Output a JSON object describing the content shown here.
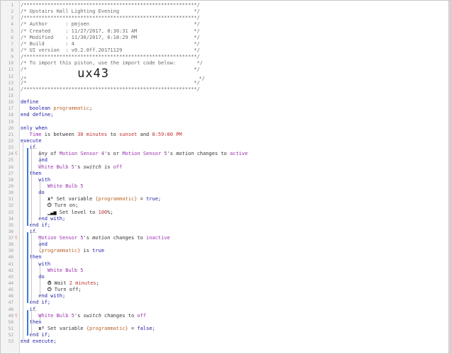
{
  "colors": {
    "keyword": "#1a1aa6",
    "device": "#9b2fae",
    "number": "#c03030",
    "comment": "#6b6b6b",
    "fold_marker": "#e07b30"
  },
  "fold_marker_glyph": "ʕ",
  "lines": [
    {
      "n": "1",
      "segs": [
        {
          "t": "/**********************************************************/",
          "c": "comment"
        }
      ]
    },
    {
      "n": "2",
      "segs": [
        {
          "t": "/* Upstairs Hall Lighting Evening                         */",
          "c": "comment"
        }
      ]
    },
    {
      "n": "3",
      "segs": [
        {
          "t": "/**********************************************************/",
          "c": "comment"
        }
      ]
    },
    {
      "n": "4",
      "segs": [
        {
          "t": "/* Author      : pmjoen                                   */",
          "c": "comment"
        }
      ]
    },
    {
      "n": "5",
      "segs": [
        {
          "t": "/* Created     : 11/27/2017, 8:30:31 AM                   */",
          "c": "comment"
        }
      ]
    },
    {
      "n": "6",
      "segs": [
        {
          "t": "/* Modified    : 11/30/2017, 6:18:29 PM                   */",
          "c": "comment"
        }
      ]
    },
    {
      "n": "7",
      "segs": [
        {
          "t": "/* Build       : 4                                        */",
          "c": "comment"
        }
      ]
    },
    {
      "n": "8",
      "segs": [
        {
          "t": "/* UI version  : v0.2.0ff.20171129                        */",
          "c": "comment"
        }
      ]
    },
    {
      "n": "9",
      "segs": [
        {
          "t": "/**********************************************************/",
          "c": "comment"
        }
      ]
    },
    {
      "n": "10",
      "segs": [
        {
          "t": "/* To import this piston, use the import code below:       */",
          "c": "comment"
        }
      ]
    },
    {
      "n": "11",
      "segs": [
        {
          "t": "/*                                                        */",
          "c": "comment"
        }
      ]
    },
    {
      "n": "12",
      "segs": [
        {
          "t": "/*                 ",
          "c": "comment"
        },
        {
          "t": "ux43",
          "c": "bigcode"
        },
        {
          "t": "                              */",
          "c": "comment"
        }
      ]
    },
    {
      "n": "13",
      "segs": [
        {
          "t": "/*                                                        */",
          "c": "comment"
        }
      ]
    },
    {
      "n": "14",
      "segs": [
        {
          "t": "/**********************************************************/",
          "c": "comment"
        }
      ]
    },
    {
      "n": "15",
      "segs": []
    },
    {
      "n": "16",
      "segs": [
        {
          "t": "define",
          "c": "keyword"
        }
      ]
    },
    {
      "n": "17",
      "segs": [
        {
          "t": "   boolean ",
          "c": "keyword"
        },
        {
          "t": "programmatic",
          "c": "var"
        },
        {
          "t": ";",
          "c": "plain"
        }
      ]
    },
    {
      "n": "18",
      "segs": [
        {
          "t": "end define;",
          "c": "keyword"
        }
      ]
    },
    {
      "n": "19",
      "segs": []
    },
    {
      "n": "20",
      "segs": [
        {
          "t": "only when",
          "c": "keyword"
        }
      ]
    },
    {
      "n": "21",
      "segs": [
        {
          "t": "   ",
          "c": "plain"
        },
        {
          "t": "Time",
          "c": "device"
        },
        {
          "t": " is between ",
          "c": "plain"
        },
        {
          "t": "30 minutes",
          "c": "number"
        },
        {
          "t": " to ",
          "c": "plain"
        },
        {
          "t": "sunset",
          "c": "number"
        },
        {
          "t": " and ",
          "c": "plain"
        },
        {
          "t": "8:59:00 PM",
          "c": "number"
        }
      ]
    },
    {
      "n": "22",
      "segs": [
        {
          "t": "execute",
          "c": "keyword"
        }
      ]
    },
    {
      "n": "23",
      "segs": [
        {
          "t": "   if",
          "c": "keyword"
        }
      ]
    },
    {
      "n": "24",
      "fold": true,
      "segs": [
        {
          "t": "      Any of ",
          "c": "plain"
        },
        {
          "t": "Motion Sensor 4",
          "c": "device"
        },
        {
          "t": "'s or ",
          "c": "plain"
        },
        {
          "t": "Motion Sensor 5",
          "c": "device"
        },
        {
          "t": "'s ",
          "c": "plain"
        },
        {
          "t": "motion",
          "c": "italic"
        },
        {
          "t": " changes to ",
          "c": "plain"
        },
        {
          "t": "active",
          "c": "device"
        }
      ]
    },
    {
      "n": "25",
      "segs": [
        {
          "t": "      and",
          "c": "keyword"
        }
      ]
    },
    {
      "n": "26",
      "segs": [
        {
          "t": "      ",
          "c": "plain"
        },
        {
          "t": "White Bulb 5",
          "c": "device"
        },
        {
          "t": "'s ",
          "c": "plain"
        },
        {
          "t": "switch",
          "c": "italic"
        },
        {
          "t": " is ",
          "c": "plain"
        },
        {
          "t": "off",
          "c": "device"
        }
      ]
    },
    {
      "n": "27",
      "segs": [
        {
          "t": "   then",
          "c": "keyword"
        }
      ]
    },
    {
      "n": "28",
      "segs": [
        {
          "t": "      with",
          "c": "keyword"
        }
      ]
    },
    {
      "n": "29",
      "segs": [
        {
          "t": "         ",
          "c": "plain"
        },
        {
          "t": "White Bulb 5",
          "c": "device"
        }
      ]
    },
    {
      "n": "30",
      "segs": [
        {
          "t": "      do",
          "c": "keyword"
        }
      ]
    },
    {
      "n": "31",
      "segs": [
        {
          "t": "         ",
          "c": "plain"
        },
        {
          "t": "x²",
          "c": "icon"
        },
        {
          "t": " Set variable ",
          "c": "plain"
        },
        {
          "t": "{programmatic}",
          "c": "var"
        },
        {
          "t": " = ",
          "c": "plain"
        },
        {
          "t": "true",
          "c": "keyword"
        },
        {
          "t": ";",
          "c": "plain"
        }
      ]
    },
    {
      "n": "32",
      "segs": [
        {
          "t": "         ",
          "c": "plain"
        },
        {
          "t": "⏻",
          "c": "icon"
        },
        {
          "t": " Turn on;",
          "c": "plain"
        }
      ]
    },
    {
      "n": "33",
      "segs": [
        {
          "t": "         ",
          "c": "plain"
        },
        {
          "t": "▁▃▅",
          "c": "icon"
        },
        {
          "t": " Set level to ",
          "c": "plain"
        },
        {
          "t": "100",
          "c": "number"
        },
        {
          "t": "%;",
          "c": "plain"
        }
      ]
    },
    {
      "n": "34",
      "segs": [
        {
          "t": "      end with;",
          "c": "keyword"
        }
      ]
    },
    {
      "n": "35",
      "segs": [
        {
          "t": "   end if;",
          "c": "keyword"
        }
      ]
    },
    {
      "n": "36",
      "segs": [
        {
          "t": "   if",
          "c": "keyword"
        }
      ]
    },
    {
      "n": "37",
      "fold": true,
      "segs": [
        {
          "t": "      ",
          "c": "plain"
        },
        {
          "t": "Motion Sensor 5",
          "c": "device"
        },
        {
          "t": "'s ",
          "c": "plain"
        },
        {
          "t": "motion",
          "c": "italic"
        },
        {
          "t": " changes to ",
          "c": "plain"
        },
        {
          "t": "inactive",
          "c": "device"
        }
      ]
    },
    {
      "n": "38",
      "segs": [
        {
          "t": "      and",
          "c": "keyword"
        }
      ]
    },
    {
      "n": "39",
      "segs": [
        {
          "t": "      ",
          "c": "plain"
        },
        {
          "t": "{programmatic}",
          "c": "var"
        },
        {
          "t": " is ",
          "c": "plain"
        },
        {
          "t": "true",
          "c": "keyword"
        }
      ]
    },
    {
      "n": "40",
      "segs": [
        {
          "t": "   then",
          "c": "keyword"
        }
      ]
    },
    {
      "n": "41",
      "segs": [
        {
          "t": "      with",
          "c": "keyword"
        }
      ]
    },
    {
      "n": "42",
      "segs": [
        {
          "t": "         ",
          "c": "plain"
        },
        {
          "t": "White Bulb 5",
          "c": "device"
        }
      ]
    },
    {
      "n": "43",
      "segs": [
        {
          "t": "      do",
          "c": "keyword"
        }
      ]
    },
    {
      "n": "44",
      "segs": [
        {
          "t": "         ",
          "c": "plain"
        },
        {
          "t": "⏱",
          "c": "icon"
        },
        {
          "t": " Wait ",
          "c": "plain"
        },
        {
          "t": "2 minutes",
          "c": "number"
        },
        {
          "t": ";",
          "c": "plain"
        }
      ]
    },
    {
      "n": "45",
      "segs": [
        {
          "t": "         ",
          "c": "plain"
        },
        {
          "t": "⏻",
          "c": "icon"
        },
        {
          "t": " Turn off;",
          "c": "plain"
        }
      ]
    },
    {
      "n": "46",
      "segs": [
        {
          "t": "      end with;",
          "c": "keyword"
        }
      ]
    },
    {
      "n": "47",
      "segs": [
        {
          "t": "   end if;",
          "c": "keyword"
        }
      ]
    },
    {
      "n": "48",
      "segs": [
        {
          "t": "   if",
          "c": "keyword"
        }
      ]
    },
    {
      "n": "49",
      "fold": true,
      "segs": [
        {
          "t": "      ",
          "c": "plain"
        },
        {
          "t": "White Bulb 5",
          "c": "device"
        },
        {
          "t": "'s ",
          "c": "plain"
        },
        {
          "t": "switch",
          "c": "italic"
        },
        {
          "t": " changes to ",
          "c": "plain"
        },
        {
          "t": "off",
          "c": "device"
        }
      ]
    },
    {
      "n": "50",
      "segs": [
        {
          "t": "   then",
          "c": "keyword"
        }
      ]
    },
    {
      "n": "51",
      "segs": [
        {
          "t": "      ",
          "c": "plain"
        },
        {
          "t": "x²",
          "c": "icon"
        },
        {
          "t": " Set variable ",
          "c": "plain"
        },
        {
          "t": "{programmatic}",
          "c": "var"
        },
        {
          "t": " = ",
          "c": "plain"
        },
        {
          "t": "false",
          "c": "keyword"
        },
        {
          "t": ";",
          "c": "plain"
        }
      ]
    },
    {
      "n": "52",
      "segs": [
        {
          "t": "   end if;",
          "c": "keyword"
        }
      ]
    },
    {
      "n": "53",
      "segs": [
        {
          "t": "end execute;",
          "c": "keyword"
        }
      ]
    }
  ]
}
